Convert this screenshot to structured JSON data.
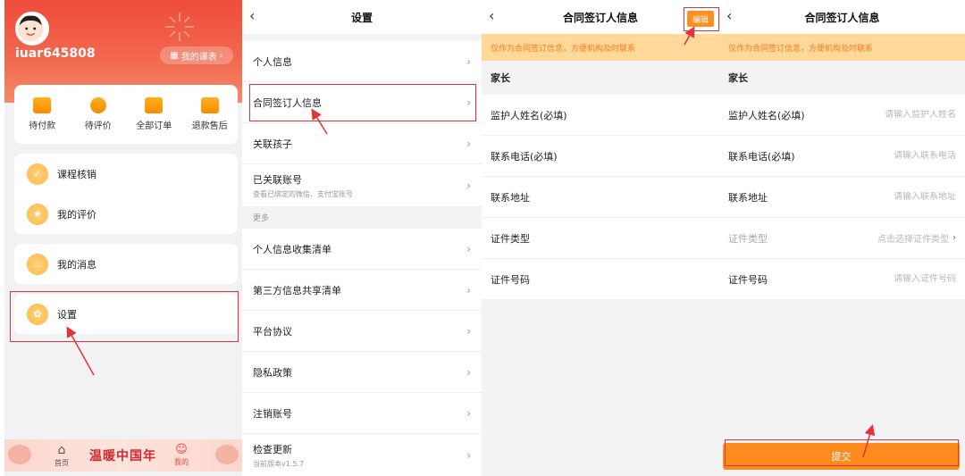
{
  "colors": {
    "brand_red": "#ef4c3c",
    "accent_orange": "#ff8a1e",
    "notice_bg": "#ffd89a",
    "notice_text": "#ff7a1a",
    "annotation_red": "#e4323a"
  },
  "profile": {
    "username": "iuar645808",
    "course_button": "我的课表",
    "orders": [
      {
        "label": "待付款",
        "icon": "wallet-icon"
      },
      {
        "label": "待评价",
        "icon": "star-icon"
      },
      {
        "label": "全部订单",
        "icon": "clipboard-icon"
      },
      {
        "label": "退款售后",
        "icon": "refund-icon"
      }
    ],
    "menu_group1": [
      "课程核销",
      "我的评价"
    ],
    "menu_group2": [
      "我的消息"
    ],
    "menu_group3": [
      "设置"
    ],
    "banner": "温暖中国年",
    "tabs": [
      {
        "label": "首页",
        "icon": "home-icon"
      },
      {
        "label": "我的",
        "icon": "person-icon"
      }
    ]
  },
  "settings": {
    "title": "设置",
    "items": [
      {
        "label": "个人信息",
        "sub": ""
      },
      {
        "label": "合同签订人信息",
        "sub": ""
      },
      {
        "label": "关联孩子",
        "sub": ""
      },
      {
        "label": "已关联账号",
        "sub": "查看已绑定的微信、支付宝账号"
      }
    ],
    "section_more": "更多",
    "more_items": [
      {
        "label": "个人信息收集清单",
        "sub": ""
      },
      {
        "label": "第三方信息共享清单",
        "sub": ""
      },
      {
        "label": "平台协议",
        "sub": ""
      },
      {
        "label": "隐私政策",
        "sub": ""
      },
      {
        "label": "注销账号",
        "sub": ""
      },
      {
        "label": "检查更新",
        "sub": "当前版本v1.5.7"
      }
    ]
  },
  "signer_view": {
    "title": "合同签订人信息",
    "edit_button": "编辑",
    "notice": "仅作为合同签订信息，方便机构及时联系",
    "group": "家长",
    "fields": [
      "监护人姓名(必填)",
      "联系电话(必填)",
      "联系地址",
      "证件类型",
      "证件号码"
    ]
  },
  "signer_edit": {
    "title": "合同签订人信息",
    "notice": "仅作为合同签订信息，方便机构及时联系",
    "group": "家长",
    "fields": [
      {
        "label": "监护人姓名(必填)",
        "placeholder": "请输入监护人姓名"
      },
      {
        "label": "联系电话(必填)",
        "placeholder": "请输入联系电话"
      },
      {
        "label": "联系地址",
        "placeholder": "请输入联系地址"
      }
    ],
    "id_type": {
      "label": "证件类型",
      "placeholder": "点击选择证件类型"
    },
    "id_number": {
      "label": "证件号码",
      "placeholder": "请输入证件号码"
    },
    "submit": "提交"
  }
}
